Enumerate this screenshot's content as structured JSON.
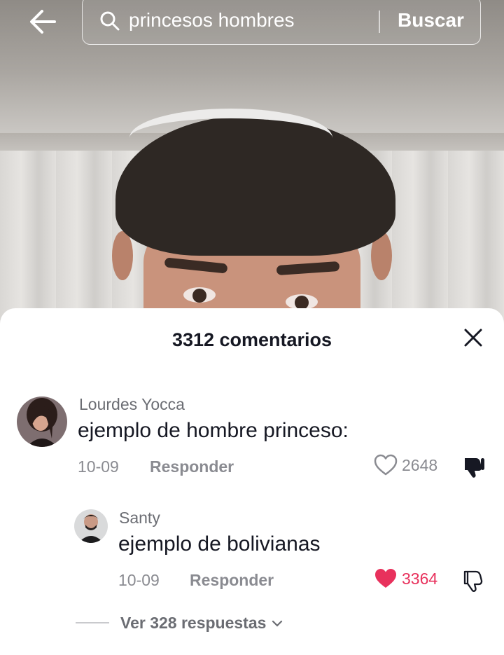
{
  "search": {
    "query": "princesos hombres",
    "button_label": "Buscar"
  },
  "comments": {
    "title": "3312 comentarios",
    "items": [
      {
        "username": "Lourdes Yocca",
        "text": "ejemplo de hombre princeso:",
        "date": "10-09",
        "reply_label": "Responder",
        "likes": "2648",
        "liked": false,
        "disliked": true
      },
      {
        "username": "Santy",
        "text": "ejemplo de bolivianas",
        "date": "10-09",
        "reply_label": "Responder",
        "likes": "3364",
        "liked": true,
        "disliked": false
      }
    ],
    "view_replies": "Ver 328 respuestas"
  },
  "colors": {
    "like_active": "#e8315c",
    "text_primary": "#161823",
    "text_secondary": "#8a8b91"
  },
  "icons": [
    "back-arrow-icon",
    "search-icon",
    "close-icon",
    "heart-outline-icon",
    "heart-filled-icon",
    "thumbs-down-filled-icon",
    "thumbs-down-outline-icon",
    "chevron-down-icon"
  ]
}
